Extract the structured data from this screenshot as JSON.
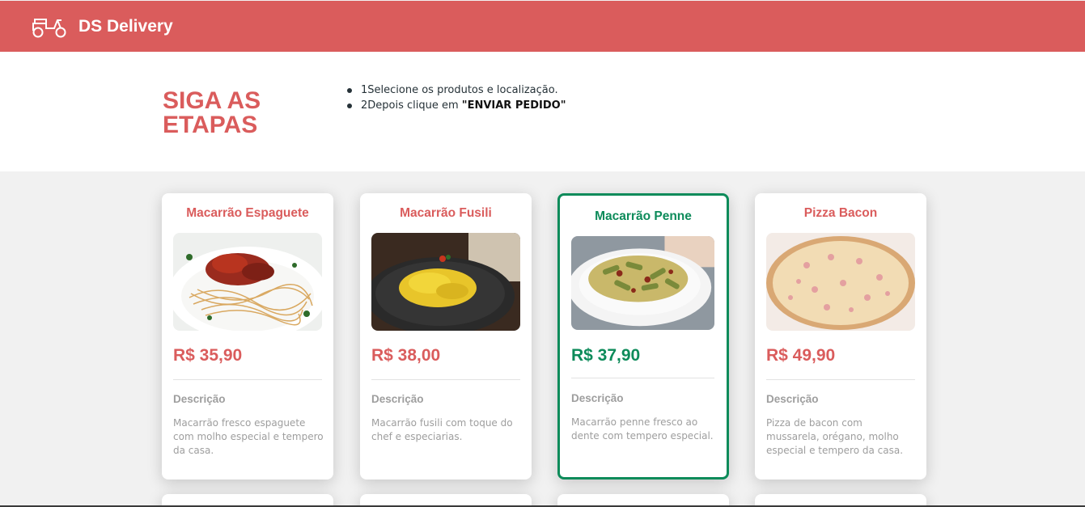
{
  "navbar": {
    "brand": "DS Delivery",
    "logo_icon": "scooter-icon"
  },
  "steps": {
    "title": "SIGA AS ETAPAS",
    "items": [
      {
        "prefix": "1Selecione os produtos e localização.",
        "bold": ""
      },
      {
        "prefix": "2Depois clique em ",
        "bold": "\"ENVIAR PEDIDO\""
      }
    ]
  },
  "colors": {
    "primary": "#da5c5c",
    "selected": "#0d8b5a",
    "muted": "#9e9e9e",
    "background": "#f1f1f1"
  },
  "products": [
    {
      "name": "Macarrão Espaguete",
      "price": "R$ 35,90",
      "desc_label": "Descrição",
      "description": "Macarrão fresco espaguete com molho especial e tempero da casa.",
      "selected": false
    },
    {
      "name": "Macarrão Fusili",
      "price": "R$ 38,00",
      "desc_label": "Descrição",
      "description": "Macarrão fusili com toque do chef e especiarias.",
      "selected": false
    },
    {
      "name": "Macarrão Penne",
      "price": "R$ 37,90",
      "desc_label": "Descrição",
      "description": "Macarrão penne fresco ao dente com tempero especial.",
      "selected": true
    },
    {
      "name": "Pizza Bacon",
      "price": "R$ 49,90",
      "desc_label": "Descrição",
      "description": "Pizza de bacon com mussarela, orégano, molho especial e tempero da casa.",
      "selected": false
    }
  ]
}
